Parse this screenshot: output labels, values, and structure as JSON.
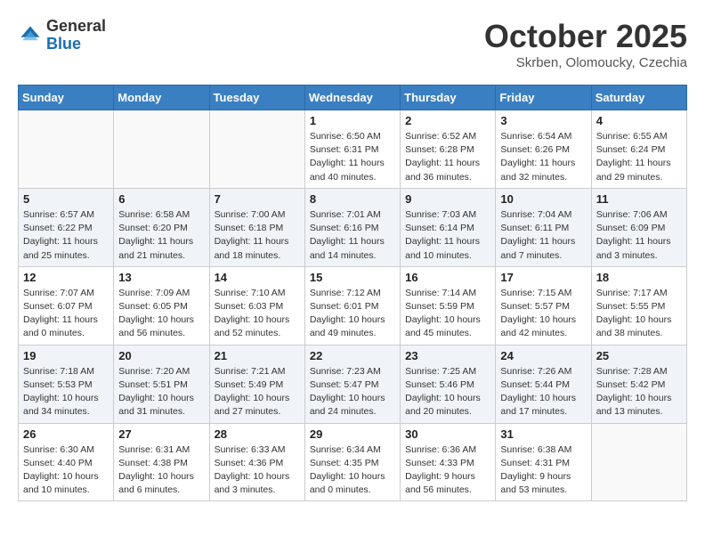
{
  "header": {
    "logo_general": "General",
    "logo_blue": "Blue",
    "month": "October 2025",
    "location": "Skrben, Olomoucky, Czechia"
  },
  "weekdays": [
    "Sunday",
    "Monday",
    "Tuesday",
    "Wednesday",
    "Thursday",
    "Friday",
    "Saturday"
  ],
  "weeks": [
    [
      {
        "day": "",
        "info": ""
      },
      {
        "day": "",
        "info": ""
      },
      {
        "day": "",
        "info": ""
      },
      {
        "day": "1",
        "info": "Sunrise: 6:50 AM\nSunset: 6:31 PM\nDaylight: 11 hours\nand 40 minutes."
      },
      {
        "day": "2",
        "info": "Sunrise: 6:52 AM\nSunset: 6:28 PM\nDaylight: 11 hours\nand 36 minutes."
      },
      {
        "day": "3",
        "info": "Sunrise: 6:54 AM\nSunset: 6:26 PM\nDaylight: 11 hours\nand 32 minutes."
      },
      {
        "day": "4",
        "info": "Sunrise: 6:55 AM\nSunset: 6:24 PM\nDaylight: 11 hours\nand 29 minutes."
      }
    ],
    [
      {
        "day": "5",
        "info": "Sunrise: 6:57 AM\nSunset: 6:22 PM\nDaylight: 11 hours\nand 25 minutes."
      },
      {
        "day": "6",
        "info": "Sunrise: 6:58 AM\nSunset: 6:20 PM\nDaylight: 11 hours\nand 21 minutes."
      },
      {
        "day": "7",
        "info": "Sunrise: 7:00 AM\nSunset: 6:18 PM\nDaylight: 11 hours\nand 18 minutes."
      },
      {
        "day": "8",
        "info": "Sunrise: 7:01 AM\nSunset: 6:16 PM\nDaylight: 11 hours\nand 14 minutes."
      },
      {
        "day": "9",
        "info": "Sunrise: 7:03 AM\nSunset: 6:14 PM\nDaylight: 11 hours\nand 10 minutes."
      },
      {
        "day": "10",
        "info": "Sunrise: 7:04 AM\nSunset: 6:11 PM\nDaylight: 11 hours\nand 7 minutes."
      },
      {
        "day": "11",
        "info": "Sunrise: 7:06 AM\nSunset: 6:09 PM\nDaylight: 11 hours\nand 3 minutes."
      }
    ],
    [
      {
        "day": "12",
        "info": "Sunrise: 7:07 AM\nSunset: 6:07 PM\nDaylight: 11 hours\nand 0 minutes."
      },
      {
        "day": "13",
        "info": "Sunrise: 7:09 AM\nSunset: 6:05 PM\nDaylight: 10 hours\nand 56 minutes."
      },
      {
        "day": "14",
        "info": "Sunrise: 7:10 AM\nSunset: 6:03 PM\nDaylight: 10 hours\nand 52 minutes."
      },
      {
        "day": "15",
        "info": "Sunrise: 7:12 AM\nSunset: 6:01 PM\nDaylight: 10 hours\nand 49 minutes."
      },
      {
        "day": "16",
        "info": "Sunrise: 7:14 AM\nSunset: 5:59 PM\nDaylight: 10 hours\nand 45 minutes."
      },
      {
        "day": "17",
        "info": "Sunrise: 7:15 AM\nSunset: 5:57 PM\nDaylight: 10 hours\nand 42 minutes."
      },
      {
        "day": "18",
        "info": "Sunrise: 7:17 AM\nSunset: 5:55 PM\nDaylight: 10 hours\nand 38 minutes."
      }
    ],
    [
      {
        "day": "19",
        "info": "Sunrise: 7:18 AM\nSunset: 5:53 PM\nDaylight: 10 hours\nand 34 minutes."
      },
      {
        "day": "20",
        "info": "Sunrise: 7:20 AM\nSunset: 5:51 PM\nDaylight: 10 hours\nand 31 minutes."
      },
      {
        "day": "21",
        "info": "Sunrise: 7:21 AM\nSunset: 5:49 PM\nDaylight: 10 hours\nand 27 minutes."
      },
      {
        "day": "22",
        "info": "Sunrise: 7:23 AM\nSunset: 5:47 PM\nDaylight: 10 hours\nand 24 minutes."
      },
      {
        "day": "23",
        "info": "Sunrise: 7:25 AM\nSunset: 5:46 PM\nDaylight: 10 hours\nand 20 minutes."
      },
      {
        "day": "24",
        "info": "Sunrise: 7:26 AM\nSunset: 5:44 PM\nDaylight: 10 hours\nand 17 minutes."
      },
      {
        "day": "25",
        "info": "Sunrise: 7:28 AM\nSunset: 5:42 PM\nDaylight: 10 hours\nand 13 minutes."
      }
    ],
    [
      {
        "day": "26",
        "info": "Sunrise: 6:30 AM\nSunset: 4:40 PM\nDaylight: 10 hours\nand 10 minutes."
      },
      {
        "day": "27",
        "info": "Sunrise: 6:31 AM\nSunset: 4:38 PM\nDaylight: 10 hours\nand 6 minutes."
      },
      {
        "day": "28",
        "info": "Sunrise: 6:33 AM\nSunset: 4:36 PM\nDaylight: 10 hours\nand 3 minutes."
      },
      {
        "day": "29",
        "info": "Sunrise: 6:34 AM\nSunset: 4:35 PM\nDaylight: 10 hours\nand 0 minutes."
      },
      {
        "day": "30",
        "info": "Sunrise: 6:36 AM\nSunset: 4:33 PM\nDaylight: 9 hours\nand 56 minutes."
      },
      {
        "day": "31",
        "info": "Sunrise: 6:38 AM\nSunset: 4:31 PM\nDaylight: 9 hours\nand 53 minutes."
      },
      {
        "day": "",
        "info": ""
      }
    ]
  ]
}
